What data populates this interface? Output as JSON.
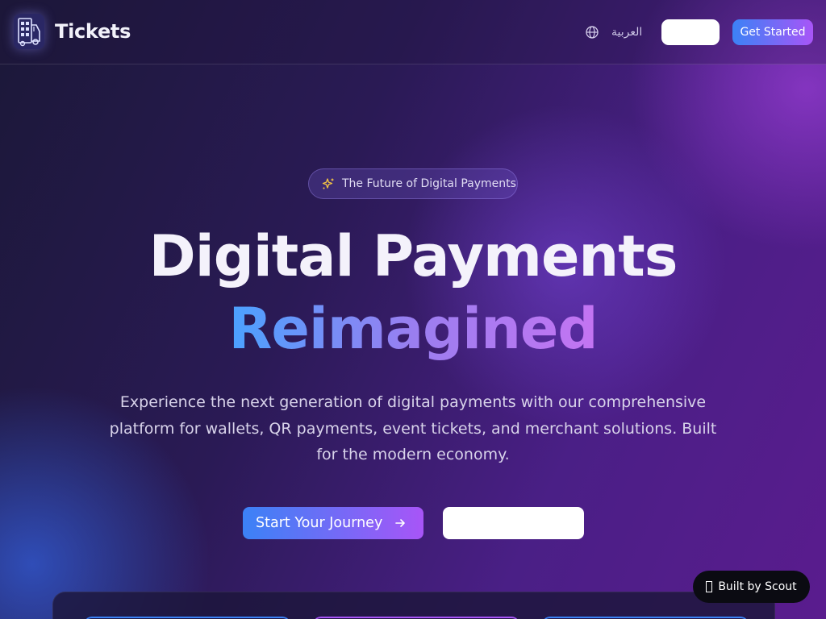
{
  "header": {
    "brand": "Tickets",
    "language_label": "العربية",
    "get_started_label": "Get Started"
  },
  "hero": {
    "badge_label": "The Future of Digital Payments",
    "title_line1": "Digital Payments",
    "title_line2": "Reimagined",
    "description": "Experience the next generation of digital payments with our comprehensive platform for wallets, QR payments, event tickets, and merchant solutions. Built for the modern economy.",
    "primary_cta_label": "Start Your Journey"
  },
  "badge": {
    "label": "Built by Scout"
  },
  "colors": {
    "accent_blue": "#3b82f6",
    "accent_purple": "#a855f7",
    "sparkle": "#f5c542"
  },
  "icons": {
    "logo": "truck-icon",
    "language": "globe-icon",
    "badge": "sparkles-icon",
    "cta": "arrow-right-icon",
    "scout": "scout-icon"
  }
}
